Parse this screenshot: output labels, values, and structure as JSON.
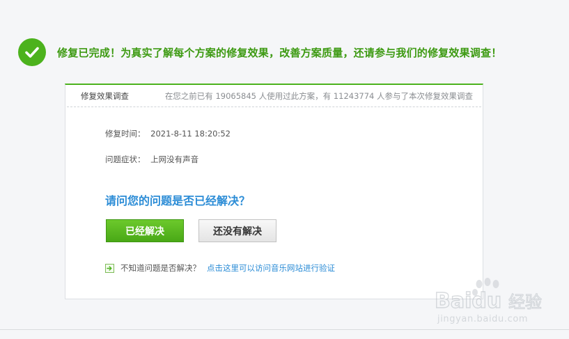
{
  "header": {
    "message": "修复已完成！为真实了解每个方案的修复效果，改善方案质量，还请参与我们的修复效果调查！",
    "icon": "checkmark-icon",
    "accent_color": "#4cb21d"
  },
  "survey": {
    "title": "修复效果调查",
    "stats": "在您之前已有 19065845 人使用过此方案，有 11243774 人参与了本次修复效果调查",
    "repair_time_label": "修复时间：",
    "repair_time_value": "2021-8-11 18:20:52",
    "symptom_label": "问题症状：",
    "symptom_value": "上网没有声音",
    "question": "请问您的问题是否已经解决？",
    "resolved_button": "已经解决",
    "unresolved_button": "还没有解决",
    "verify_question": "不知道问题是否解决？",
    "verify_link": "点击这里可以访问音乐网站进行验证",
    "question_color": "#2b8cd6"
  },
  "watermark": {
    "brand": "Baidu",
    "brand_cn": "经验",
    "url": "jingyan.baidu.com"
  }
}
